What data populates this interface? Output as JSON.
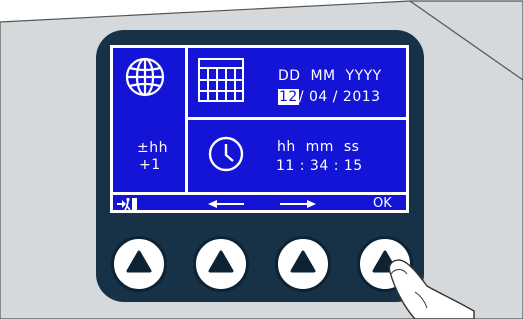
{
  "colors": {
    "screen_bg": "#1414d6",
    "screen_fg": "#ffffff",
    "bezel": "#173247",
    "casing": "#d6d9db",
    "key_symbol": "#0d2233"
  },
  "left_pane": {
    "icon": "globe-icon",
    "offset_label": "±hh",
    "offset_value": "+1"
  },
  "date_pane": {
    "icon": "calendar-icon",
    "format_label": "DD  MM  YYYY",
    "day": "12",
    "rest": "/ 04 / 2013"
  },
  "time_pane": {
    "icon": "clock-icon",
    "format_label": "hh  mm  ss",
    "value": "11 : 34 : 15"
  },
  "softkeys": [
    {
      "icon": "exit-icon",
      "label": ""
    },
    {
      "icon": "arrow-left-icon",
      "label": ""
    },
    {
      "icon": "arrow-right-icon",
      "label": ""
    },
    {
      "icon": "",
      "label": "OK"
    }
  ]
}
